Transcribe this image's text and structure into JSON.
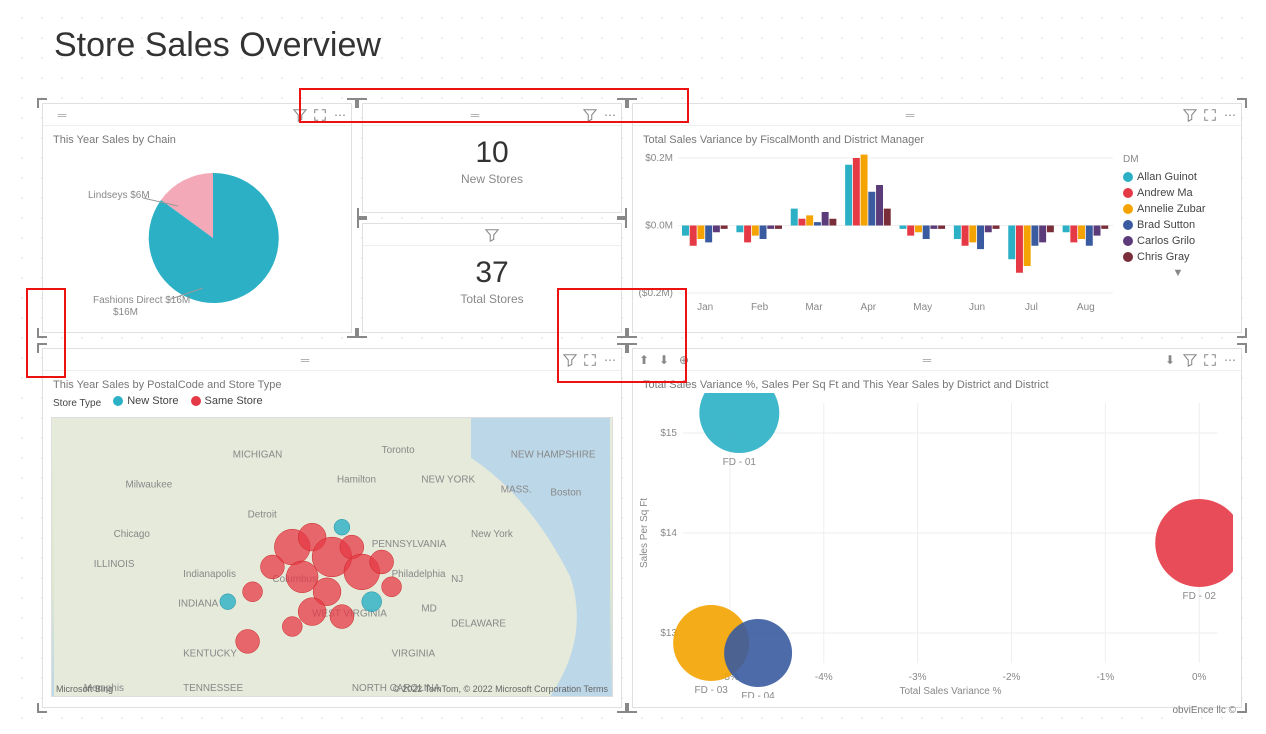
{
  "page_title": "Store Sales Overview",
  "attribution": "obviEnce llc ©",
  "visuals": {
    "pie": {
      "title": "This Year Sales by Chain",
      "slices": [
        {
          "label": "Lindseys",
          "value_label": "Lindseys $6M",
          "value": 6,
          "color": "#f4a9b8"
        },
        {
          "label": "Fashions Direct",
          "value_label": "Fashions Direct $16M",
          "value": 16,
          "color": "#2bb0c5"
        }
      ]
    },
    "card_new": {
      "value": "10",
      "label": "New Stores"
    },
    "card_total": {
      "value": "37",
      "label": "Total Stores"
    },
    "variance_bar": {
      "title": "Total Sales Variance by FiscalMonth and District Manager",
      "legend_title": "DM",
      "legend": [
        {
          "label": "Allan Guinot",
          "color": "#2bb0c5"
        },
        {
          "label": "Andrew Ma",
          "color": "#e63946"
        },
        {
          "label": "Annelie Zubar",
          "color": "#f4a300"
        },
        {
          "label": "Brad Sutton",
          "color": "#3a5ba0"
        },
        {
          "label": "Carlos Grilo",
          "color": "#5c3b7a"
        },
        {
          "label": "Chris Gray",
          "color": "#7a2e3a"
        }
      ]
    },
    "map": {
      "title": "This Year Sales by PostalCode and Store Type",
      "legend_title": "Store Type",
      "legend": [
        {
          "label": "New Store",
          "color": "#2bb0c5"
        },
        {
          "label": "Same Store",
          "color": "#e63946"
        }
      ],
      "map_attrib_left": "Microsoft Bing",
      "map_attrib_right": "© 2022 TomTom, © 2022 Microsoft Corporation  Terms"
    },
    "scatter": {
      "title": "Total Sales Variance %, Sales Per Sq Ft and This Year Sales by District and District",
      "xlabel": "Total Sales Variance %",
      "ylabel": "Sales Per Sq Ft"
    }
  },
  "chart_data": [
    {
      "type": "pie",
      "title": "This Year Sales by Chain",
      "series": [
        {
          "name": "Chain",
          "values": [
            {
              "label": "Lindseys",
              "value": 6
            },
            {
              "label": "Fashions Direct",
              "value": 16
            }
          ]
        }
      ]
    },
    {
      "type": "bar",
      "title": "Total Sales Variance by FiscalMonth and District Manager",
      "categories": [
        "Jan",
        "Feb",
        "Mar",
        "Apr",
        "May",
        "Jun",
        "Jul",
        "Aug"
      ],
      "yticks": [
        "$0.2M",
        "$0.0M",
        "($0.2M)"
      ],
      "ylim": [
        -0.2,
        0.2
      ],
      "series": [
        {
          "name": "Allan Guinot",
          "color": "#2bb0c5",
          "values": [
            -0.03,
            -0.02,
            0.05,
            0.18,
            -0.01,
            -0.04,
            -0.1,
            -0.02
          ]
        },
        {
          "name": "Andrew Ma",
          "color": "#e63946",
          "values": [
            -0.06,
            -0.05,
            0.02,
            0.2,
            -0.03,
            -0.06,
            -0.14,
            -0.05
          ]
        },
        {
          "name": "Annelie Zubar",
          "color": "#f4a300",
          "values": [
            -0.04,
            -0.03,
            0.03,
            0.21,
            -0.02,
            -0.05,
            -0.12,
            -0.04
          ]
        },
        {
          "name": "Brad Sutton",
          "color": "#3a5ba0",
          "values": [
            -0.05,
            -0.04,
            0.01,
            0.1,
            -0.04,
            -0.07,
            -0.06,
            -0.06
          ]
        },
        {
          "name": "Carlos Grilo",
          "color": "#5c3b7a",
          "values": [
            -0.02,
            -0.01,
            0.04,
            0.12,
            -0.01,
            -0.02,
            -0.05,
            -0.03
          ]
        },
        {
          "name": "Chris Gray",
          "color": "#7a2e3a",
          "values": [
            -0.01,
            -0.01,
            0.02,
            0.05,
            -0.01,
            -0.01,
            -0.02,
            -0.01
          ]
        }
      ]
    },
    {
      "type": "scatter",
      "title": "Total Sales Variance %, Sales Per Sq Ft and This Year Sales by District and District",
      "xlabel": "Total Sales Variance %",
      "ylabel": "Sales Per Sq Ft",
      "xticks": [
        "-5%",
        "-4%",
        "-3%",
        "-2%",
        "-1%",
        "0%"
      ],
      "yticks": [
        "$13",
        "$14",
        "$15"
      ],
      "points": [
        {
          "label": "FD - 01",
          "x": -4.9,
          "y": 15.2,
          "size": 40,
          "color": "#2bb0c5"
        },
        {
          "label": "FD - 02",
          "x": 0.0,
          "y": 13.9,
          "size": 44,
          "color": "#e63946"
        },
        {
          "label": "FD - 03",
          "x": -5.2,
          "y": 12.9,
          "size": 38,
          "color": "#f4a300"
        },
        {
          "label": "FD - 04",
          "x": -4.7,
          "y": 12.8,
          "size": 34,
          "color": "#3a5ba0"
        }
      ]
    }
  ]
}
